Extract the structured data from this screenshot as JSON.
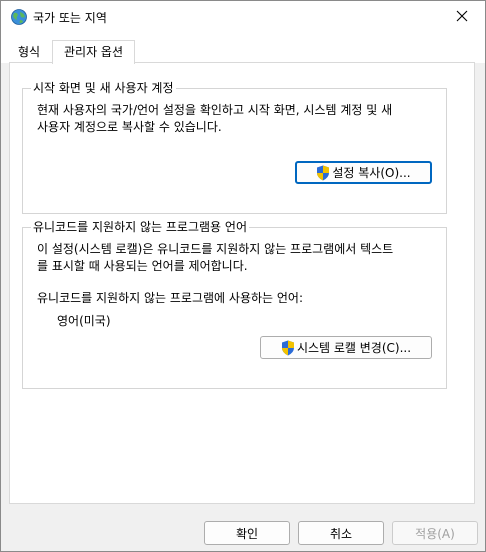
{
  "window": {
    "title": "국가 또는 지역",
    "icon": "globe-icon",
    "close_icon": "close-icon"
  },
  "tabs": [
    {
      "label": "형식",
      "selected": false
    },
    {
      "label": "관리자 옵션",
      "selected": true
    }
  ],
  "welcome_group": {
    "title": "시작 화면 및 새 사용자 계정",
    "description_line1": "현재 사용자의 국가/언어 설정을 확인하고 시작 화면, 시스템 계정 및 새",
    "description_line2": "사용자 계정으로 복사할 수 있습니다.",
    "copy_button": "설정 복사(O)..."
  },
  "unicode_group": {
    "title": "유니코드를 지원하지 않는 프로그램용 언어",
    "description_line1": "이 설정(시스템 로캘)은 유니코드를 지원하지 않는 프로그램에서 텍스트",
    "description_line2": "를 표시할 때 사용되는 언어를 제어합니다.",
    "current_label": "유니코드를 지원하지 않는 프로그램에 사용하는 언어:",
    "current_value": "영어(미국)",
    "change_button": "시스템 로캘 변경(C)..."
  },
  "footer": {
    "ok": "확인",
    "cancel": "취소",
    "apply": "적용(A)"
  },
  "colors": {
    "accent": "#0067c0",
    "shield_blue": "#2b6cd8",
    "shield_yellow": "#f2c200"
  }
}
